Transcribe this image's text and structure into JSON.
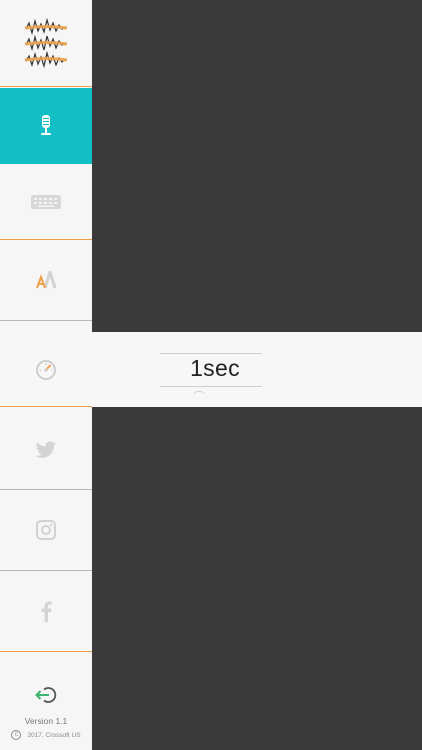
{
  "sidebar": {
    "items": [
      {
        "name": "logo",
        "icon": "audio-waveform-logo"
      },
      {
        "name": "voice-input",
        "icon": "microphone-icon",
        "active": true
      },
      {
        "name": "keyboard",
        "icon": "keyboard-icon"
      },
      {
        "name": "font",
        "icon": "font-letter-a-icon"
      },
      {
        "name": "speed",
        "icon": "speedometer-icon"
      },
      {
        "name": "twitter",
        "icon": "twitter-icon"
      },
      {
        "name": "instagram",
        "icon": "instagram-icon"
      },
      {
        "name": "facebook",
        "icon": "facebook-icon"
      },
      {
        "name": "logout",
        "icon": "logout-icon"
      }
    ],
    "version": "Version 1.1",
    "copyright": "2017, Crossoft US",
    "copyright_symbol": "C"
  },
  "picker": {
    "value": "1sec"
  },
  "colors": {
    "accent_teal": "#12bfc4",
    "accent_orange": "#f0a04b",
    "logout_green": "#3db46e",
    "dark_panel": "#3a3a3a"
  }
}
